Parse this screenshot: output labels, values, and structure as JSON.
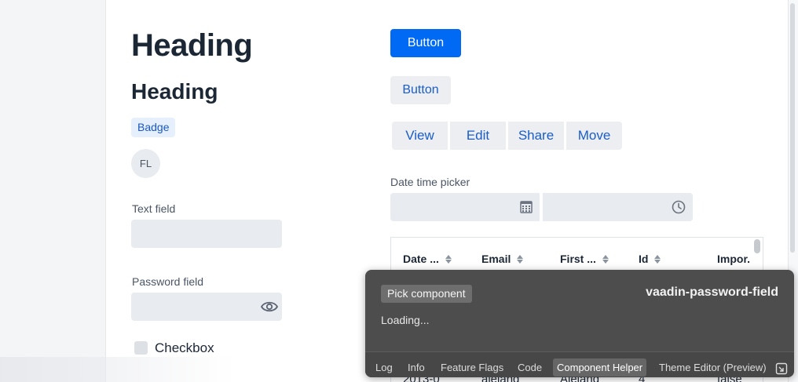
{
  "left_column": {
    "heading_large": "Heading",
    "heading_medium": "Heading",
    "badge": "Badge",
    "avatar_initials": "FL",
    "text_field": {
      "label": "Text field",
      "value": ""
    },
    "password_field": {
      "label": "Password field",
      "value": "",
      "icon": "eye-icon"
    },
    "checkbox": {
      "label": "Checkbox",
      "checked": false
    }
  },
  "right_column": {
    "primary_button": "Button",
    "secondary_button": "Button",
    "button_group": [
      "View",
      "Edit",
      "Share",
      "Move"
    ],
    "date_time_picker": {
      "label": "Date time picker",
      "date_value": "",
      "time_value": "",
      "date_icon": "calendar-icon",
      "time_icon": "clock-icon"
    },
    "grid": {
      "columns": [
        "Date ...",
        "Email",
        "First ...",
        "Id",
        "Impor."
      ],
      "visible_row": [
        "2013-0",
        "alejand",
        "Alejand",
        "4",
        "false"
      ]
    }
  },
  "devtools": {
    "pick_button": "Pick component",
    "selected_component": "vaadin-password-field",
    "status": "Loading...",
    "tabs": [
      "Log",
      "Info",
      "Feature Flags",
      "Code",
      "Component Helper",
      "Theme Editor (Preview)"
    ],
    "active_tab": "Component Helper",
    "popout_icon": "popout-icon"
  },
  "colors": {
    "primary": "#006af5",
    "primary_text": "#1a5dc8",
    "field_bg": "#e8ebef",
    "devtools_bg": "#4d4d4d"
  }
}
